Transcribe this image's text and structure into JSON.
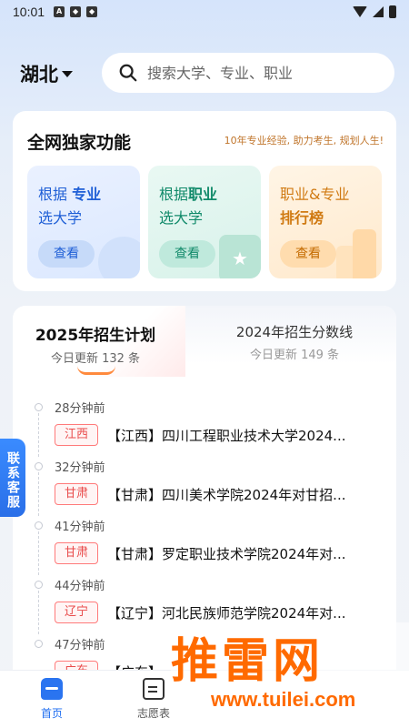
{
  "status_bar": {
    "time": "10:01"
  },
  "header": {
    "city": "湖北",
    "search_placeholder": "搜索大学、专业、职业"
  },
  "features": {
    "title": "全网独家功能",
    "slogan": "10年专业经验, 助力考生, 规划人生!",
    "cards": [
      {
        "line1_prefix": "根据",
        "line1_bold": "专业",
        "line2": "选大学",
        "button": "查看"
      },
      {
        "line1_prefix": "根据",
        "line1_bold": "职业",
        "line2": "选大学",
        "button": "查看"
      },
      {
        "line1_prefix": "职业&专业",
        "line1_bold": "",
        "line2": "排行榜",
        "button": "查看"
      }
    ]
  },
  "plan": {
    "tabs": [
      {
        "title": "2025年招生计划",
        "sub": "今日更新 132 条"
      },
      {
        "title": "2024年招生分数线",
        "sub": "今日更新 149 条"
      }
    ],
    "items": [
      {
        "time": "28分钟前",
        "province": "江西",
        "title": "【江西】四川工程职业技术大学2024..."
      },
      {
        "time": "32分钟前",
        "province": "甘肃",
        "title": "【甘肃】四川美术学院2024年对甘招..."
      },
      {
        "time": "41分钟前",
        "province": "甘肃",
        "title": "【甘肃】罗定职业技术学院2024年对..."
      },
      {
        "time": "44分钟前",
        "province": "辽宁",
        "title": "【辽宁】河北民族师范学院2024年对..."
      },
      {
        "time": "47分钟前",
        "province": "广东",
        "title": "【广东】"
      }
    ]
  },
  "side_button": "联系客服",
  "nav": {
    "home": "首页",
    "apply": "志愿表"
  },
  "watermark": {
    "text": "推雷网",
    "url": "www.tuilei.com"
  },
  "colors": {
    "accent": "#1f6ef0",
    "province_tag": "#e94c4c",
    "watermark": "#ff6a00"
  }
}
